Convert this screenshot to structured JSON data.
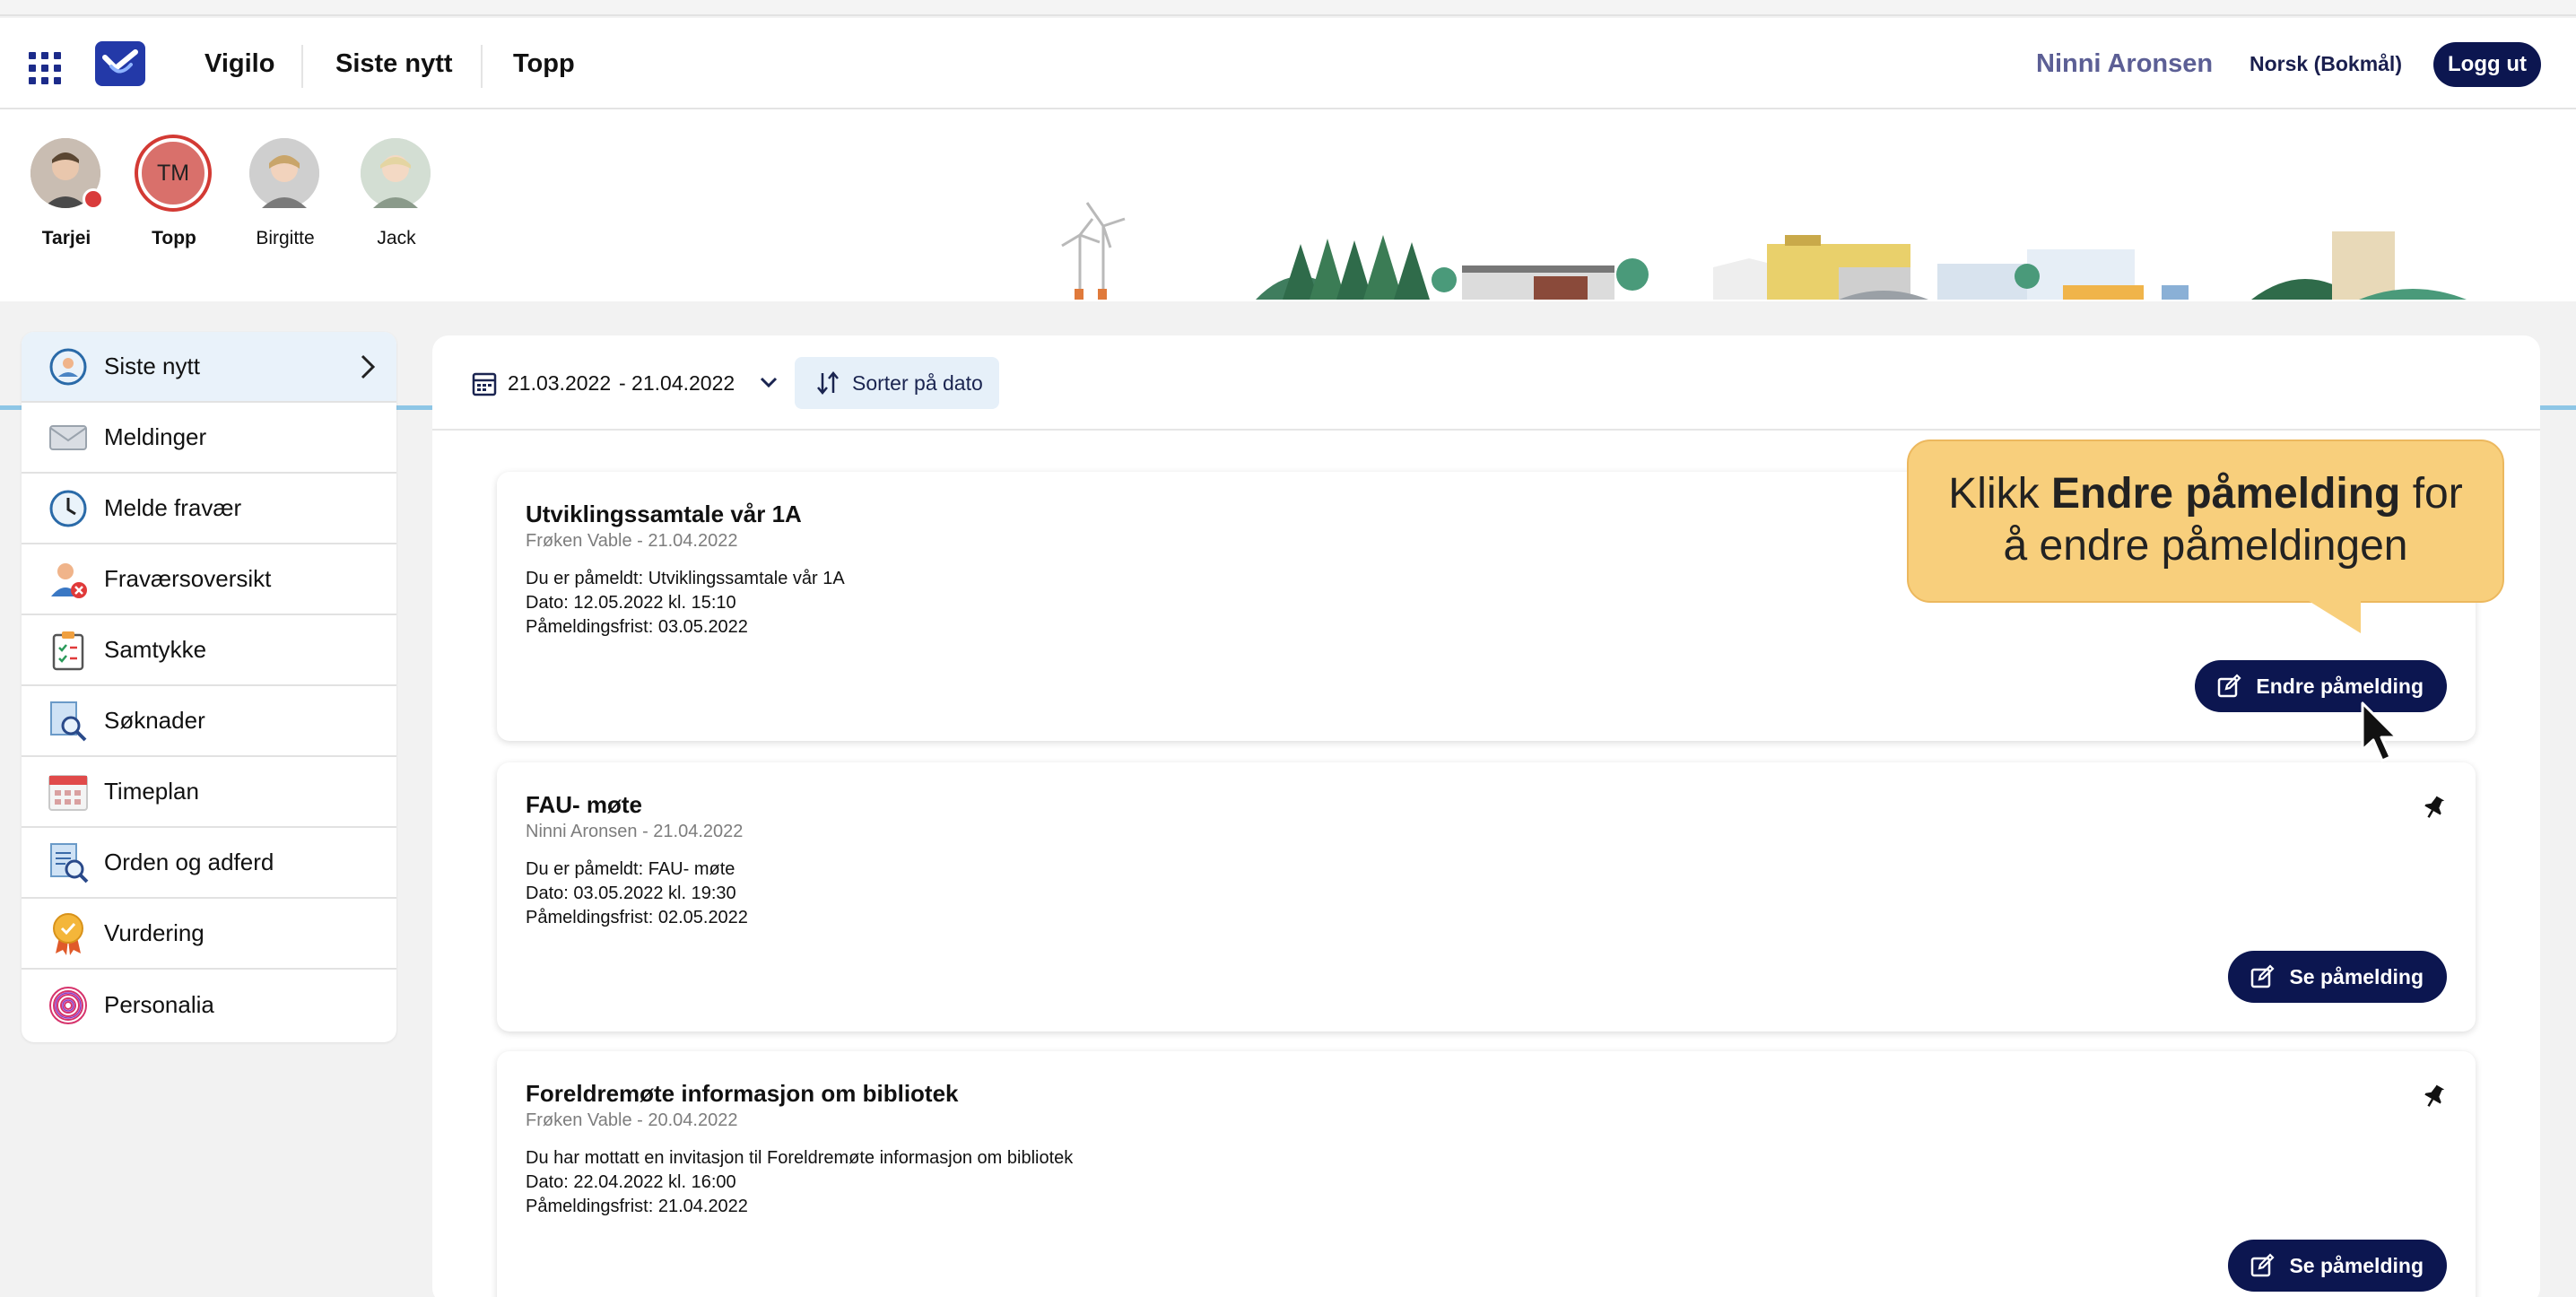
{
  "nav": {
    "brand": "Vigilo",
    "links": [
      "Siste nytt",
      "Topp"
    ],
    "user": "Ninni Aronsen",
    "language": "Norsk (Bokmål)",
    "logout": "Logg ut"
  },
  "children": [
    {
      "name": "Tarjei",
      "has_alert": true
    },
    {
      "name": "Topp",
      "initials": "TM",
      "selected": true
    },
    {
      "name": "Birgitte"
    },
    {
      "name": "Jack"
    }
  ],
  "sidebar": {
    "items": [
      {
        "label": "Siste nytt",
        "icon": "news-icon",
        "active": true
      },
      {
        "label": "Meldinger",
        "icon": "envelope-icon"
      },
      {
        "label": "Melde fravær",
        "icon": "clock-icon"
      },
      {
        "label": "Fraværsoversikt",
        "icon": "absence-person-icon"
      },
      {
        "label": "Samtykke",
        "icon": "clipboard-checklist-icon"
      },
      {
        "label": "Søknader",
        "icon": "document-search-icon"
      },
      {
        "label": "Timeplan",
        "icon": "calendar-icon"
      },
      {
        "label": "Orden og adferd",
        "icon": "conduct-document-icon"
      },
      {
        "label": "Vurdering",
        "icon": "award-medal-icon"
      },
      {
        "label": "Personalia",
        "icon": "fingerprint-icon"
      }
    ]
  },
  "toolbar": {
    "date_from": "21.03.2022",
    "date_to": "- 21.04.2022",
    "sort_label": "Sorter på dato"
  },
  "cards": [
    {
      "title": "Utviklingssamtale vår 1A",
      "meta": "Frøken Vable - 21.04.2022",
      "lines": [
        "Du er påmeldt: Utviklingssamtale vår 1A",
        "Dato: 12.05.2022 kl. 15:10",
        "Påmeldingsfrist: 03.05.2022"
      ],
      "action": "Endre påmelding"
    },
    {
      "title": "FAU- møte",
      "meta": "Ninni Aronsen - 21.04.2022",
      "lines": [
        "Du er påmeldt: FAU- møte",
        "Dato: 03.05.2022 kl. 19:30",
        "Påmeldingsfrist: 02.05.2022"
      ],
      "action": "Se påmelding"
    },
    {
      "title": "Foreldremøte informasjon om bibliotek",
      "meta": "Frøken Vable - 20.04.2022",
      "lines": [
        "Du har mottatt en invitasjon til Foreldremøte informasjon om bibliotek",
        "Dato: 22.04.2022 kl. 16:00",
        "Påmeldingsfrist: 21.04.2022"
      ],
      "action": "Se påmelding"
    }
  ],
  "tooltip": {
    "pre": "Klikk ",
    "bold": "Endre påmelding",
    "post": " for",
    "line2": "å endre påmeldingen"
  },
  "colors": {
    "primary": "#0c1650",
    "accent_user": "#5c5f95",
    "tooltip": "#f8cf7c",
    "active_item": "#e9f2fa"
  }
}
